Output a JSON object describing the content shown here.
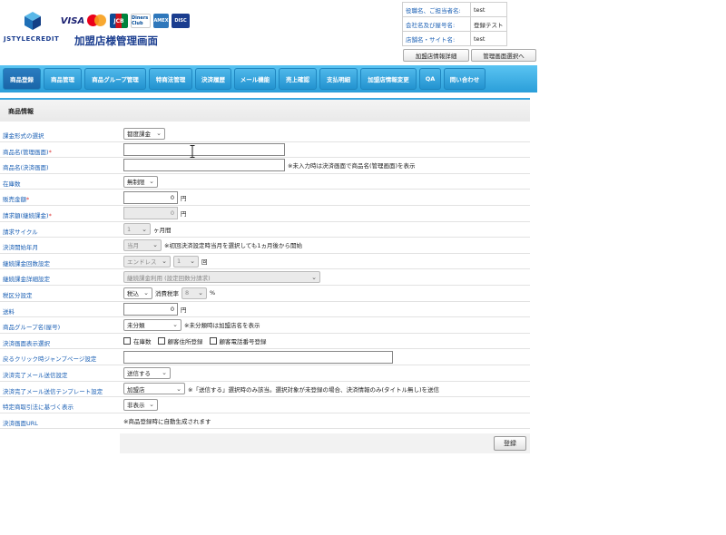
{
  "header": {
    "logo_text": "JSTYLECREDIT",
    "title": "加盟店様管理画面",
    "cards": [
      "VISA",
      "mastercard",
      "JCB",
      "Diners Club",
      "AMERICAN EXPRESS",
      "DISCOVER"
    ],
    "card_labels": {
      "visa": "VISA",
      "jcb": "JCB",
      "diners": "Diners Club",
      "amex": "AMEX",
      "discover": "DISC"
    },
    "info": [
      {
        "label": "役職名、ご担当者名:",
        "value": "test"
      },
      {
        "label": "会社名及び屋号名:",
        "value": "登録テスト"
      },
      {
        "label": "店舗名・サイト名:",
        "value": "test"
      }
    ],
    "buttons": {
      "detail": "加盟店情報詳細",
      "switch": "管理画面選択へ"
    }
  },
  "nav": {
    "items": [
      "商品登録",
      "商品管理",
      "商品グループ管理",
      "特商法管理",
      "決済履歴",
      "メール機能",
      "売上確認",
      "支払明細",
      "加盟店情報変更",
      "QA",
      "問い合わせ"
    ],
    "active_index": 0
  },
  "section": {
    "title": "商品情報"
  },
  "form": {
    "billing_type": {
      "label": "課金形式の選択",
      "value": "都度課金"
    },
    "product_name_admin": {
      "label": "商品名(管理画面)",
      "required": "*",
      "value": ""
    },
    "product_name_checkout": {
      "label": "商品名(決済画面)",
      "value": "",
      "note": "※未入力時は決済画面で商品名(管理画面)を表示"
    },
    "stock": {
      "label": "在庫数",
      "value": "無制限"
    },
    "price": {
      "label": "販売金額",
      "required": "*",
      "value": "0",
      "unit": "円"
    },
    "recurring_amount": {
      "label": "請求額(継続課金)",
      "required": "*",
      "value": "0",
      "unit": "円"
    },
    "billing_cycle": {
      "label": "請求サイクル",
      "value": "1",
      "unit": "ヶ月間"
    },
    "start_month": {
      "label": "決済開始年月",
      "value": "当月",
      "note": "※初回決済設定時当月を選択しても1ヵ月後から開始"
    },
    "recurring_count": {
      "label": "継続課金回数設定",
      "value": "エンドレス",
      "count": "1",
      "unit": "回"
    },
    "recurring_detail": {
      "label": "継続課金詳細設定",
      "value": "継続課金利用 (設定回数分請求)"
    },
    "tax": {
      "label": "税区分設定",
      "value": "税込",
      "rate_label": "消費税率",
      "rate": "8",
      "unit": "%"
    },
    "shipping": {
      "label": "送料",
      "value": "0",
      "unit": "円"
    },
    "group": {
      "label": "商品グループ名(屋号)",
      "value": "未分類",
      "note": "※未分類時は加盟店名を表示"
    },
    "display_options": {
      "label": "決済画面表示選択",
      "options": [
        "在庫数",
        "顧客住所登録",
        "顧客電話番号登録"
      ]
    },
    "back_url": {
      "label": "戻るクリック時ジャンプページ設定",
      "value": ""
    },
    "mail_send": {
      "label": "決済完了メール送信設定",
      "value": "送信する"
    },
    "mail_template": {
      "label": "決済完了メール送信テンプレート設定",
      "value": "加盟店",
      "note": "※「送信する」選択時のみ該当。選択対象が未登録の場合、決済情報のみ(タイトル無し)を送信"
    },
    "tokushoho": {
      "label": "特定商取引法に基づく表示",
      "value": "非表示"
    },
    "checkout_url": {
      "label": "決済画面URL",
      "value": "※商品登録時に自動生成されます"
    },
    "submit": "登録"
  },
  "colors": {
    "accent": "#2a9ed9",
    "label_blue": "#1a5fb4",
    "brand_navy": "#1a3d8f"
  }
}
